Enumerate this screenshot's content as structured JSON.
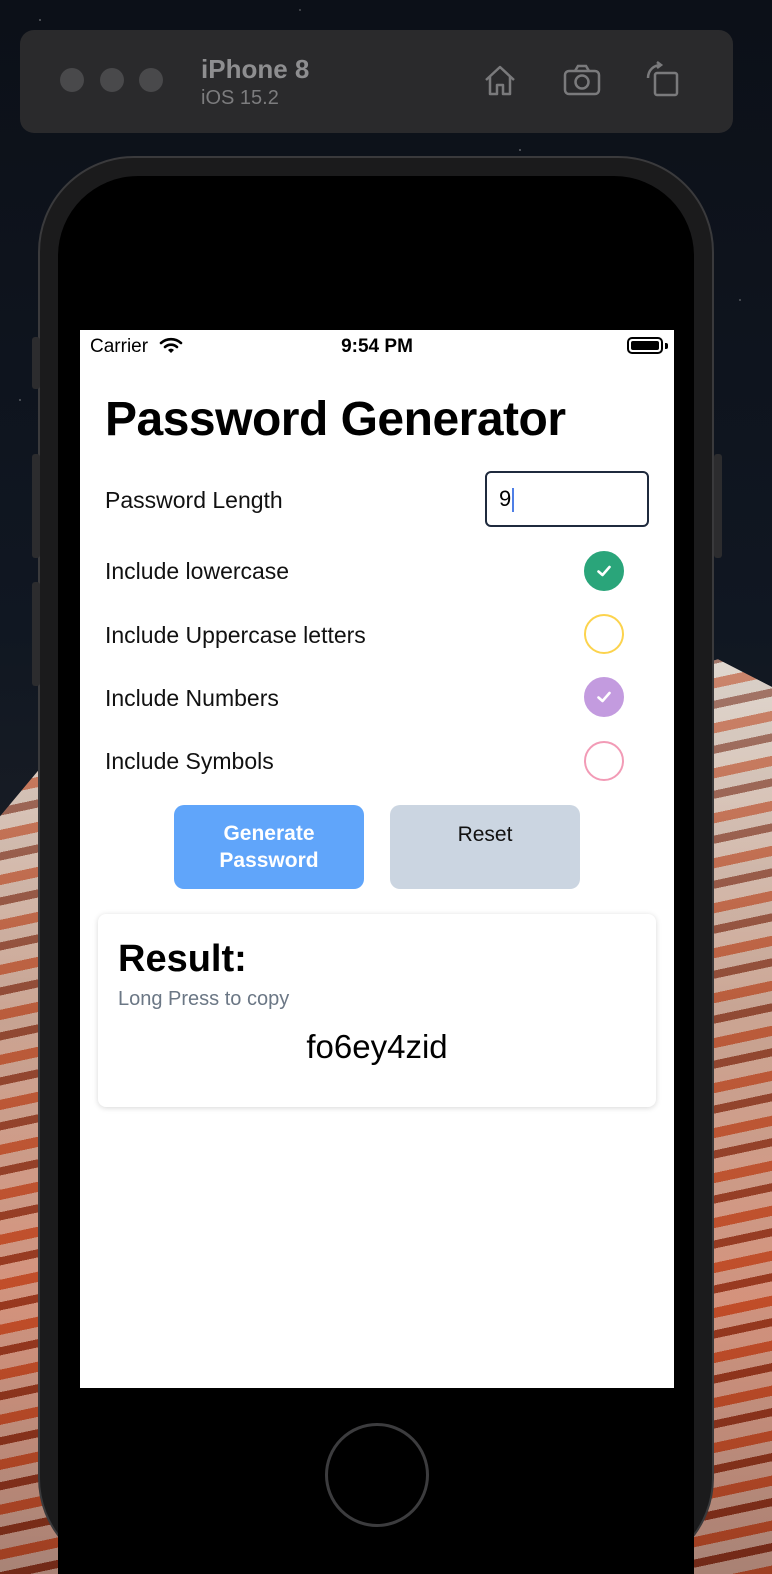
{
  "simulator": {
    "device_name": "iPhone 8",
    "os_version": "iOS 15.2",
    "home_icon": "home-icon",
    "screenshot_icon": "camera-icon",
    "rotate_icon": "rotate-icon"
  },
  "status_bar": {
    "carrier": "Carrier",
    "time": "9:54 PM"
  },
  "app": {
    "title": "Password Generator",
    "length_label": "Password Length",
    "length_value": "9",
    "options": [
      {
        "label": "Include lowercase",
        "checked": true,
        "color": "#2aa57a"
      },
      {
        "label": "Include Uppercase letters",
        "checked": false,
        "color": "#fcd34d"
      },
      {
        "label": "Include Numbers",
        "checked": true,
        "color": "#c39bdf"
      },
      {
        "label": "Include Symbols",
        "checked": false,
        "color": "#f29bb6"
      }
    ],
    "generate_label_line1": "Generate",
    "generate_label_line2": "Password",
    "reset_label": "Reset",
    "result_title": "Result:",
    "result_hint": "Long Press to copy",
    "result_value": "fo6ey4zid"
  },
  "colors": {
    "generate_button": "#60a5fa",
    "reset_button": "#cbd5e1"
  }
}
